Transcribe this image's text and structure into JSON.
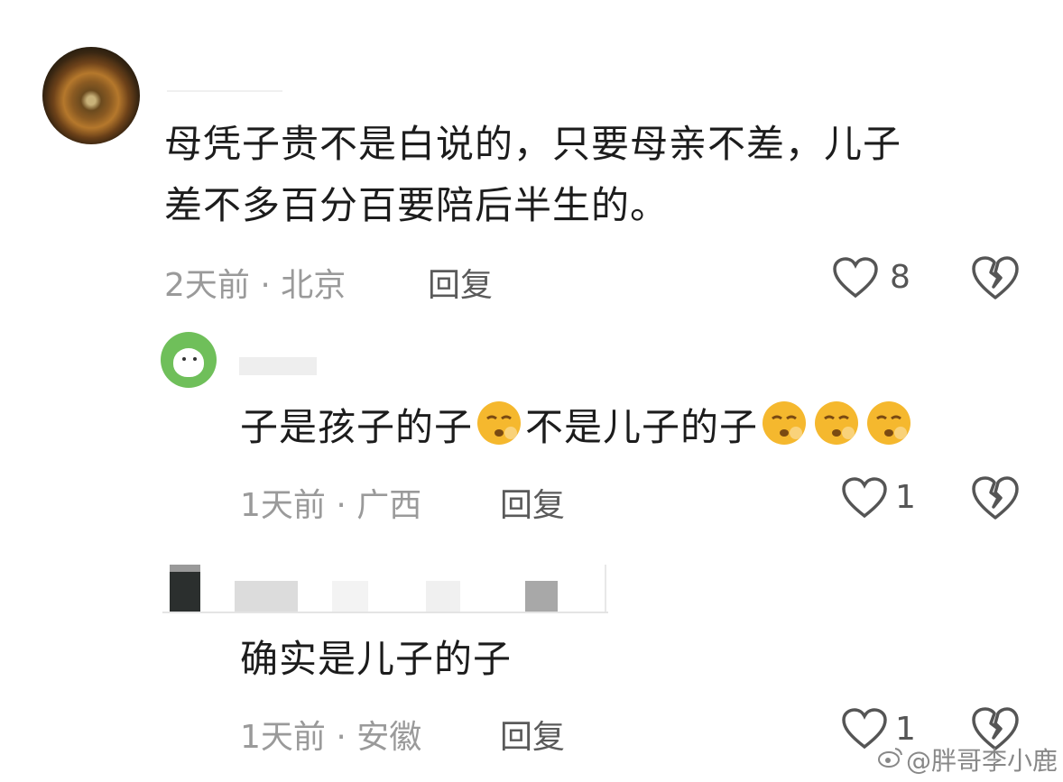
{
  "comments": [
    {
      "text": "母凭子贵不是白说的，只要母亲不差，儿子差不多百分百要陪后半生的。",
      "line1": "母凭子贵不是白说的，只要母亲不差，儿子",
      "line2": "差不多百分百要陪后半生的。",
      "meta": "2天前 · 北京",
      "reply_label": "回复",
      "likes": "8",
      "avatar_icon": "avatar-eye-photo"
    },
    {
      "text_part1": "子是孩子的子",
      "text_part2": "不是儿子的子",
      "emoji": "😮‍💨",
      "meta": "1天前 · 广西",
      "reply_label": "回复",
      "likes": "1",
      "avatar_icon": "avatar-green-cartoon"
    },
    {
      "text": "确实是儿子的子",
      "meta": "1天前 · 安徽",
      "reply_label": "回复",
      "likes": "1"
    }
  ],
  "watermark": "@胖哥李小鹿",
  "colors": {
    "text": "#1c1c1c",
    "meta": "#9a9a9a",
    "icon": "#555555",
    "emoji_face": "#f5b82e"
  }
}
